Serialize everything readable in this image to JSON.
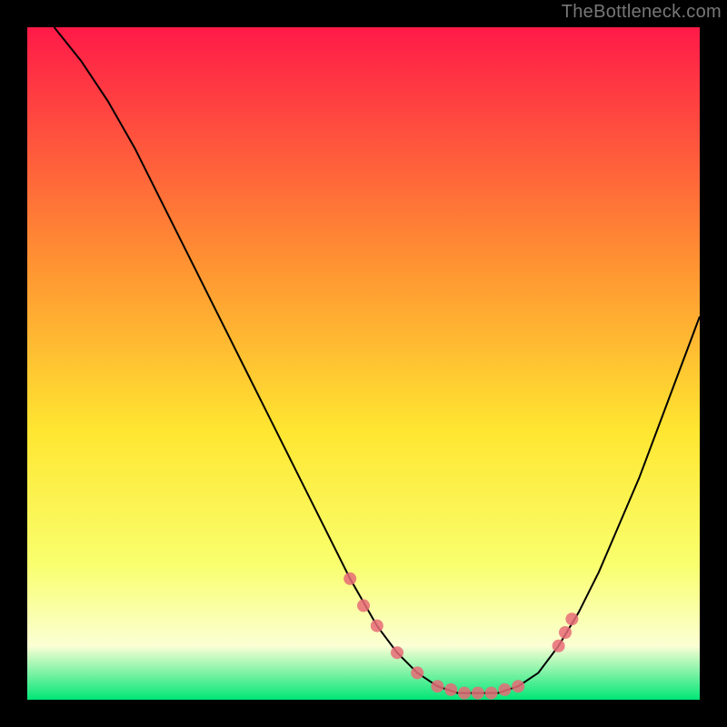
{
  "attribution": "TheBottleneck.com",
  "colors": {
    "black": "#000000",
    "curve": "#000000",
    "marker_fill": "#e76b77",
    "marker_stroke": "#7e2b33",
    "gradient_top": "#ff1a48",
    "gradient_upper": "#ff9232",
    "gradient_mid": "#ffe631",
    "gradient_lower": "#f9ff6e",
    "gradient_pale": "#fbffd4",
    "gradient_green": "#00e676"
  },
  "chart_data": {
    "type": "line",
    "title": "",
    "xlabel": "",
    "ylabel": "",
    "xlim": [
      0,
      100
    ],
    "ylim": [
      0,
      100
    ],
    "curve": {
      "x": [
        4,
        8,
        12,
        16,
        20,
        24,
        28,
        32,
        36,
        40,
        44,
        48,
        52,
        55,
        58,
        61,
        64,
        67,
        70,
        73,
        76,
        79,
        82,
        85,
        88,
        91,
        94,
        97,
        100
      ],
      "y": [
        100,
        95,
        89,
        82,
        74,
        66,
        58,
        50,
        42,
        34,
        26,
        18,
        11,
        7,
        4,
        2,
        1,
        1,
        1,
        2,
        4,
        8,
        13,
        19,
        26,
        33,
        41,
        49,
        57
      ]
    },
    "markers": {
      "x": [
        48,
        50,
        52,
        55,
        58,
        61,
        63,
        65,
        67,
        69,
        71,
        73,
        79,
        80,
        81
      ],
      "y": [
        18,
        14,
        11,
        7,
        4,
        2,
        1.5,
        1,
        1,
        1,
        1.5,
        2,
        8,
        10,
        12
      ]
    },
    "gradient_stops": [
      {
        "offset": 0.0,
        "color_key": "gradient_top"
      },
      {
        "offset": 0.35,
        "color_key": "gradient_upper"
      },
      {
        "offset": 0.6,
        "color_key": "gradient_mid"
      },
      {
        "offset": 0.8,
        "color_key": "gradient_lower"
      },
      {
        "offset": 0.92,
        "color_key": "gradient_pale"
      },
      {
        "offset": 1.0,
        "color_key": "gradient_green"
      }
    ]
  }
}
